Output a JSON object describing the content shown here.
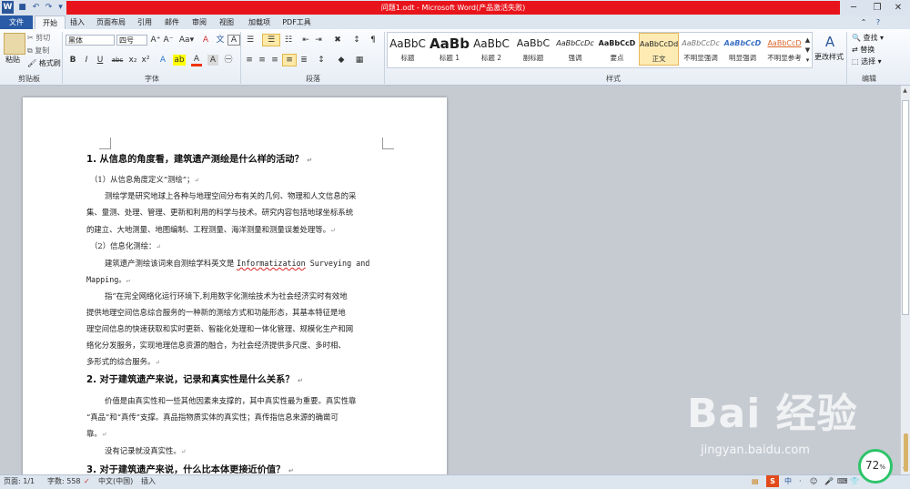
{
  "window": {
    "title": "问题1.odt - Microsoft Word(产品激活失败)",
    "controls": [
      "─",
      "❐",
      "✕"
    ]
  },
  "qat": [
    "W",
    "💾",
    "↶",
    "↷",
    "▾"
  ],
  "tabs": [
    "文件",
    "开始",
    "插入",
    "页面布局",
    "引用",
    "邮件",
    "审阅",
    "视图",
    "加载项",
    "PDF工具"
  ],
  "ribbon": {
    "clipboard": {
      "paste": "粘贴",
      "cut": "剪切",
      "copy": "复制",
      "format_painter": "格式刷",
      "label": "剪贴板"
    },
    "font": {
      "name": "黑体",
      "size": "四号",
      "label": "字体",
      "grow": "A⁺",
      "shrink": "A⁻",
      "case": "Aa▾",
      "clear": "A",
      "bold": "B",
      "italic": "I",
      "underline": "U",
      "strike": "abc",
      "sub": "x₂",
      "sup": "x²",
      "color": "A",
      "highlight": "ab",
      "phonetic": "文",
      "border_char": "A"
    },
    "paragraph": {
      "label": "段落"
    },
    "styles": {
      "label": "样式",
      "items": [
        {
          "sample": "AaBbC",
          "name": "标题"
        },
        {
          "sample": "AaBb",
          "name": "标题 1"
        },
        {
          "sample": "AaBbC",
          "name": "标题 2"
        },
        {
          "sample": "AaBbC",
          "name": "副标题"
        },
        {
          "sample": "AaBbCcDc",
          "name": "强调"
        },
        {
          "sample": "AaBbCcD",
          "name": "要点"
        },
        {
          "sample": "AaBbCcDd",
          "name": "正文"
        },
        {
          "sample": "AaBbCcDc",
          "name": "不明显强调"
        },
        {
          "sample": "AaBbCcD",
          "name": "明显强调"
        },
        {
          "sample": "AaBbCcD",
          "name": "不明显参考"
        }
      ],
      "change": "更改样式"
    },
    "editing": {
      "find": "查找",
      "replace": "替换",
      "select": "选择",
      "label": "编辑"
    }
  },
  "document": {
    "lines": [
      {
        "t": "1. 从信息的角度看，建筑遗产测绘是什么样的活动？",
        "kind": "h"
      },
      {
        "t": "（1）从信息角度定义“测绘”；",
        "kind": "p"
      },
      {
        "t": "测绘学是研究地球上各种与地理空间分布有关的几何、物理和人文信息的采",
        "kind": "p"
      },
      {
        "t": "集、量测、处理、管理、更新和利用的科学与技术。研究内容包括地球坐标系统",
        "kind": "p"
      },
      {
        "t": "的建立、大地测量、地图编制、工程测量、海洋测量和测量误差处理等。",
        "kind": "p"
      },
      {
        "t": "（2）信息化测绘：",
        "kind": "p"
      },
      {
        "t": "建筑遗产测绘该词来自测绘学科英文是",
        "kind": "p",
        "term": "Informatization",
        "rest": " Surveying and"
      },
      {
        "t": "Mapping。",
        "kind": "p"
      },
      {
        "t": "指”在完全网络化运行环境下,利用数字化测绘技术为社会经济实时有效地",
        "kind": "p"
      },
      {
        "t": "提供地理空间信息综合服务的一种新的测绘方式和功能形态，其基本特征是地",
        "kind": "p"
      },
      {
        "t": "理空间信息的快速获取和实时更新、智能化处理和一体化管理、规模化生产和网",
        "kind": "p"
      },
      {
        "t": "络化分发服务，实现地理信息资源的融合，为社会经济提供多尺度、多时相、",
        "kind": "p"
      },
      {
        "t": "多形式的综合服务。",
        "kind": "p"
      },
      {
        "t": "2. 对于建筑遗产来说，记录和真实性是什么关系？",
        "kind": "h"
      },
      {
        "t": "价值是由真实性和一些其他因素来支撑的，其中真实性最为重要。真实性靠",
        "kind": "p"
      },
      {
        "t": "“真品”和“真传”支撑。真品指物质实体的真实性；真传指信息来源的确凿可",
        "kind": "p"
      },
      {
        "t": "靠。",
        "kind": "p"
      },
      {
        "t": "没有记录就没真实性。",
        "kind": "p"
      },
      {
        "t": "3. 对于建筑遗产来说，什么比本体更接近价值？",
        "kind": "h"
      }
    ],
    "para_mark": "↵"
  },
  "status": {
    "page": "页面: 1/1",
    "words": "字数: 558",
    "lang": "中文(中国)",
    "mode": "插入",
    "zoom_pct": "72",
    "ime": [
      "S",
      "中",
      "·",
      "☺",
      "🎤",
      "⌨",
      "👕",
      "⚙"
    ]
  },
  "watermark": {
    "main": "Bai 经验",
    "sub": "jingyan.baidu.com"
  }
}
